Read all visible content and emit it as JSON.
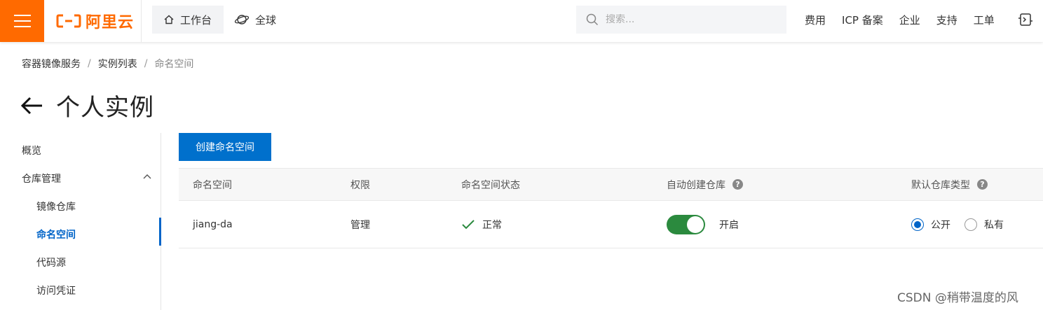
{
  "topbar": {
    "brand": "阿里云",
    "home_label": "工作台",
    "global_label": "全球",
    "search_placeholder": "搜索...",
    "links": [
      "费用",
      "ICP 备案",
      "企业",
      "支持",
      "工单"
    ],
    "colors": {
      "brand": "#ff6a00",
      "primary": "#0064c8",
      "toggle_on": "#2b8a3e"
    }
  },
  "breadcrumb": {
    "item1": "容器镜像服务",
    "item2": "实例列表",
    "current": "命名空间",
    "separator": "/"
  },
  "page_title": "个人实例",
  "sidebar": {
    "overview": "概览",
    "repo_mgmt": "仓库管理",
    "image_repo": "镜像仓库",
    "namespace": "命名空间",
    "code_source": "代码源",
    "access_cred": "访问凭证"
  },
  "main": {
    "create_button": "创建命名空间",
    "headers": {
      "namespace": "命名空间",
      "permission": "权限",
      "status": "命名空间状态",
      "auto_create": "自动创建仓库",
      "default_type": "默认仓库类型"
    },
    "row": {
      "namespace": "jiang-da",
      "permission": "管理",
      "status": "正常",
      "auto_create_state": "开启",
      "auto_create_on": true,
      "radio_public": "公开",
      "radio_private": "私有",
      "default_type_selected": "公开"
    }
  },
  "watermark": "CSDN @稍带温度的风"
}
